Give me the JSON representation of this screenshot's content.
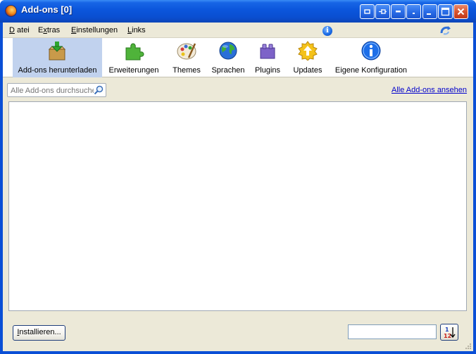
{
  "window": {
    "title": "Add-ons [0]",
    "app_icon": "firefox-icon",
    "buttons": [
      "tray-icon",
      "pin-icon",
      "rollup-icon",
      "menu-icon",
      "minimize-icon",
      "maximize-icon",
      "close-icon"
    ]
  },
  "menubar": {
    "items": [
      {
        "label": "Datei",
        "mnemonic_index": 0
      },
      {
        "label": "Extras",
        "mnemonic_index": 1
      },
      {
        "label": "Einstellungen",
        "mnemonic_index": 0
      },
      {
        "label": "Links",
        "mnemonic_index": 0
      }
    ],
    "info_icon": "info-icon",
    "throbber_icon": "throbber-icon"
  },
  "toolbar": {
    "items": [
      {
        "label": "Add-ons herunterladen",
        "icon": "download-box-icon",
        "selected": true
      },
      {
        "label": "Erweiterungen",
        "icon": "puzzle-piece-icon",
        "selected": false
      },
      {
        "label": "Themes",
        "icon": "palette-icon",
        "selected": false
      },
      {
        "label": "Sprachen",
        "icon": "globe-icon",
        "selected": false
      },
      {
        "label": "Plugins",
        "icon": "lego-brick-icon",
        "selected": false
      },
      {
        "label": "Updates",
        "icon": "update-arrow-icon",
        "selected": false
      },
      {
        "label": "Eigene Konfiguration",
        "icon": "info-icon",
        "selected": false
      }
    ]
  },
  "search": {
    "placeholder": "Alle Add-ons durchsuche",
    "value": ""
  },
  "links": {
    "view_all": "Alle Add-ons ansehen"
  },
  "footer": {
    "install_label": "Installieren...",
    "sort_value": "",
    "sort_icon": "sort-order-icon"
  },
  "colors": {
    "titlebar": "#0a4fd6",
    "client_bg": "#ece9d8",
    "selected_tab": "#c1d2ee",
    "link": "#0000cc"
  }
}
